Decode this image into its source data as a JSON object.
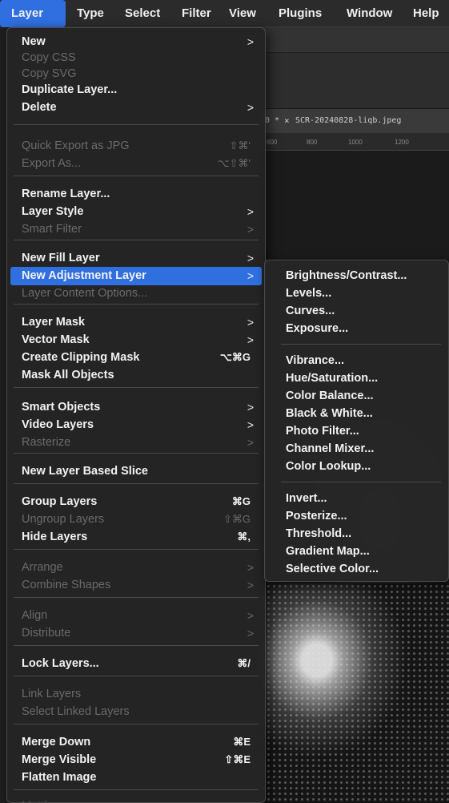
{
  "menubar": {
    "items": [
      "Layer",
      "Type",
      "Select",
      "Filter",
      "View",
      "Plugins",
      "Window",
      "Help"
    ],
    "accent": "#2f6fe0"
  },
  "background": {
    "tab_prev": "0 *",
    "tab_close": "×",
    "tab_file": "SCR-20240828-liqb.jpeg",
    "ruler": [
      "600",
      "800",
      "1000",
      "1200"
    ]
  },
  "layer_menu": {
    "items": [
      {
        "label": "New",
        "arrow": ">"
      },
      {
        "label": "Copy CSS"
      },
      {
        "label": "Copy SVG"
      },
      {
        "label": "Duplicate Layer..."
      },
      {
        "label": "Delete",
        "arrow": ">"
      },
      {
        "label": "Quick Export as JPG",
        "shortcut": "⇧⌘'"
      },
      {
        "label": "Export As...",
        "shortcut": "⌥⇧⌘'"
      },
      {
        "label": "Rename Layer..."
      },
      {
        "label": "Layer Style",
        "arrow": ">"
      },
      {
        "label": "Smart Filter",
        "arrow": ">"
      },
      {
        "label": "New Fill Layer",
        "arrow": ">"
      },
      {
        "label": "New Adjustment Layer",
        "arrow": ">"
      },
      {
        "label": "Layer Content Options..."
      },
      {
        "label": "Layer Mask",
        "arrow": ">"
      },
      {
        "label": "Vector Mask",
        "arrow": ">"
      },
      {
        "label": "Create Clipping Mask",
        "shortcut": "⌥⌘G"
      },
      {
        "label": "Mask All Objects"
      },
      {
        "label": "Smart Objects",
        "arrow": ">"
      },
      {
        "label": "Video Layers",
        "arrow": ">"
      },
      {
        "label": "Rasterize",
        "arrow": ">"
      },
      {
        "label": "New Layer Based Slice"
      },
      {
        "label": "Group Layers",
        "shortcut": "⌘G"
      },
      {
        "label": "Ungroup Layers",
        "shortcut": "⇧⌘G"
      },
      {
        "label": "Hide Layers",
        "shortcut": "⌘,"
      },
      {
        "label": "Arrange",
        "arrow": ">"
      },
      {
        "label": "Combine Shapes",
        "arrow": ">"
      },
      {
        "label": "Align",
        "arrow": ">"
      },
      {
        "label": "Distribute",
        "arrow": ">"
      },
      {
        "label": "Lock Layers...",
        "shortcut": "⌘/"
      },
      {
        "label": "Link Layers"
      },
      {
        "label": "Select Linked Layers"
      },
      {
        "label": "Merge Down",
        "shortcut": "⌘E"
      },
      {
        "label": "Merge Visible",
        "shortcut": "⇧⌘E"
      },
      {
        "label": "Flatten Image"
      },
      {
        "label": "Matting",
        "arrow": ">"
      }
    ]
  },
  "adjustment_submenu": {
    "items": [
      "Brightness/Contrast...",
      "Levels...",
      "Curves...",
      "Exposure...",
      "Vibrance...",
      "Hue/Saturation...",
      "Color Balance...",
      "Black & White...",
      "Photo Filter...",
      "Channel Mixer...",
      "Color Lookup...",
      "Invert...",
      "Posterize...",
      "Threshold...",
      "Gradient Map...",
      "Selective Color..."
    ]
  }
}
